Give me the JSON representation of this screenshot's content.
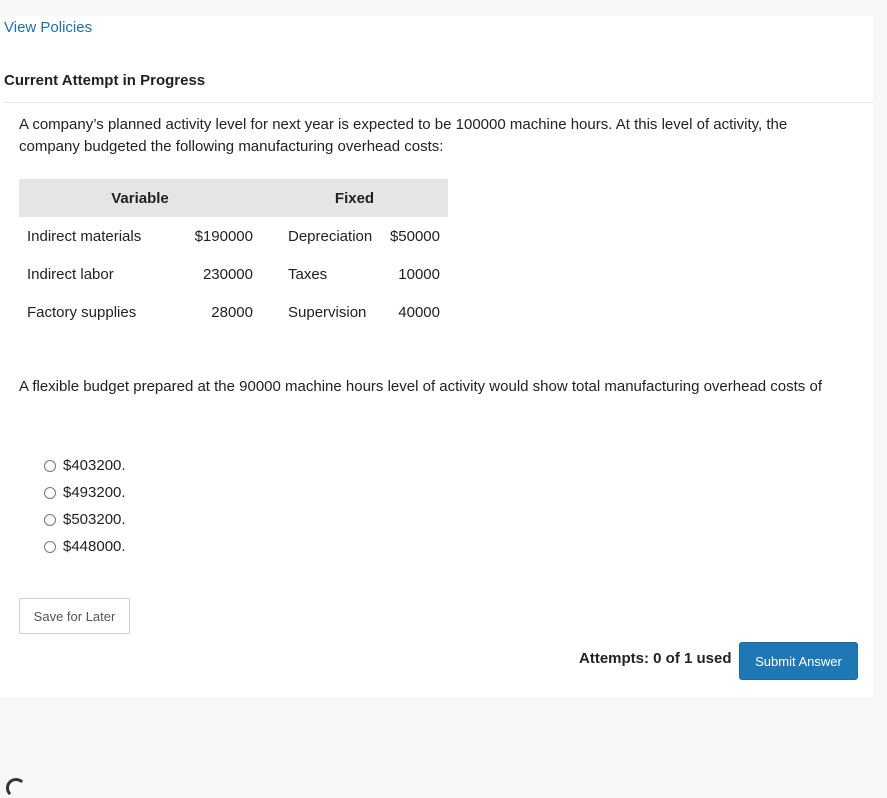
{
  "header": {
    "view_policies": "View Policies",
    "attempt_status": "Current Attempt in Progress"
  },
  "question": {
    "intro": "A company’s planned activity level for next year is expected to be 100000 machine hours. At this level of activity, the company budgeted the following manufacturing overhead costs:",
    "table": {
      "headers": {
        "variable": "Variable",
        "fixed": "Fixed"
      },
      "rows": [
        {
          "var_label": "Indirect materials",
          "var_value": "$190000",
          "fixed_label": "Depreciation",
          "fixed_value": "$50000"
        },
        {
          "var_label": "Indirect labor",
          "var_value": "230000",
          "fixed_label": "Taxes",
          "fixed_value": "10000"
        },
        {
          "var_label": "Factory supplies",
          "var_value": "28000",
          "fixed_label": "Supervision",
          "fixed_value": "40000"
        }
      ]
    },
    "prompt": "A flexible budget prepared at the 90000 machine hours level of activity would show total manufacturing overhead costs of",
    "options": [
      "$403200.",
      "$493200.",
      "$503200.",
      "$448000."
    ]
  },
  "actions": {
    "save_label": "Save for Later",
    "attempts_text": "Attempts: 0 of 1 used",
    "submit_label": "Submit Answer"
  },
  "colors": {
    "link": "#1f6fa8",
    "submit_bg": "#1f78b4",
    "table_header_bg": "#e5e5e5"
  }
}
